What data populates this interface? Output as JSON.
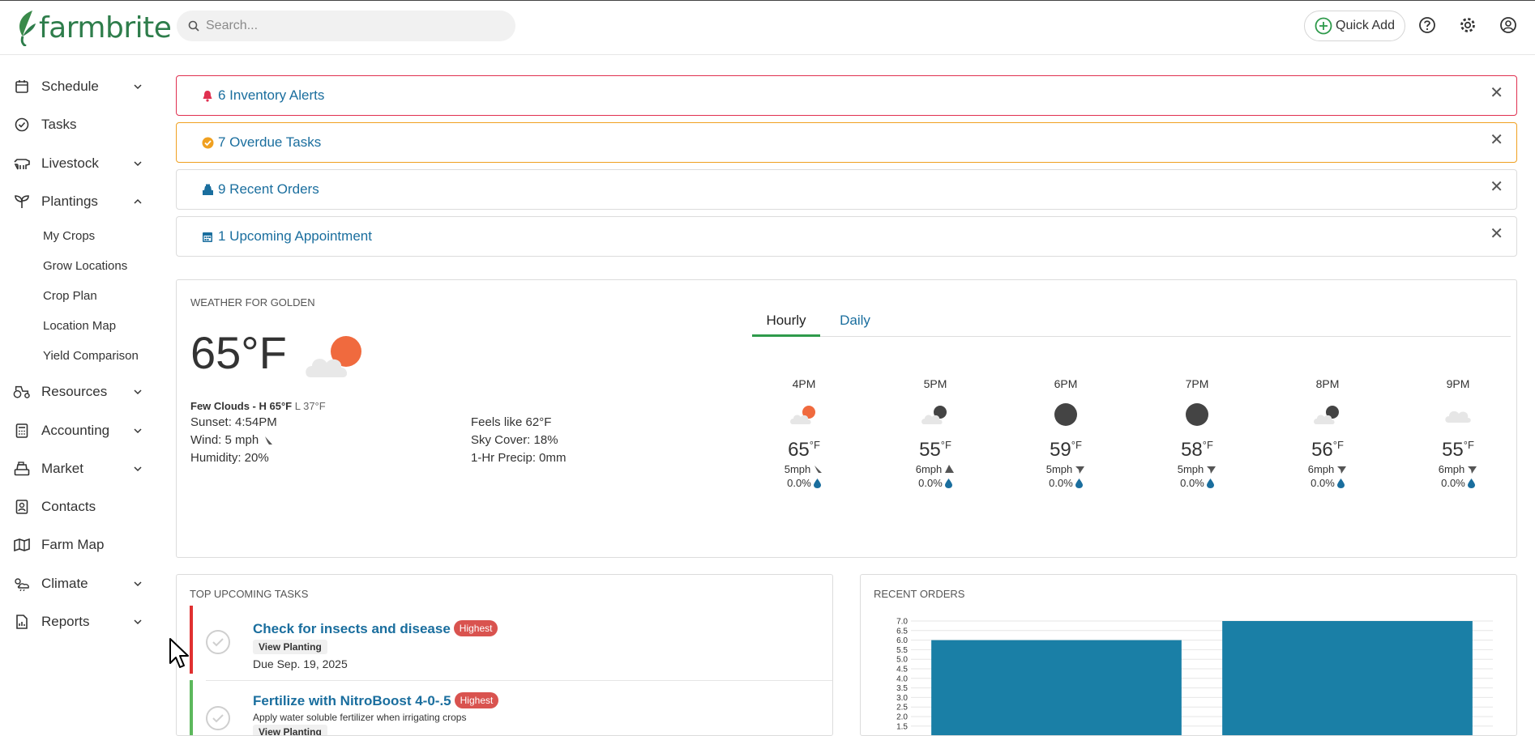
{
  "brand": {
    "name": "farmbrite",
    "logo_color": "#2e7d4b"
  },
  "search": {
    "placeholder": "Search..."
  },
  "header": {
    "quick_add_label": "Quick Add",
    "icons": [
      "plus-circle-icon",
      "help-icon",
      "gear-icon",
      "user-icon"
    ]
  },
  "sidebar": {
    "items": [
      {
        "label": "Schedule",
        "icon": "calendar-icon",
        "expandable": true
      },
      {
        "label": "Tasks",
        "icon": "check-circle-icon",
        "expandable": false
      },
      {
        "label": "Livestock",
        "icon": "cow-icon",
        "expandable": true
      },
      {
        "label": "Plantings",
        "icon": "sprout-icon",
        "expandable": true,
        "expanded": true
      },
      {
        "label": "Resources",
        "icon": "tractor-icon",
        "expandable": true
      },
      {
        "label": "Accounting",
        "icon": "calculator-icon",
        "expandable": true
      },
      {
        "label": "Market",
        "icon": "cash-register-icon",
        "expandable": true
      },
      {
        "label": "Contacts",
        "icon": "contact-card-icon",
        "expandable": false
      },
      {
        "label": "Farm Map",
        "icon": "map-icon",
        "expandable": false
      },
      {
        "label": "Climate",
        "icon": "weather-icon",
        "expandable": true
      },
      {
        "label": "Reports",
        "icon": "report-icon",
        "expandable": true
      }
    ],
    "plantings_sub": [
      "My Crops",
      "Grow Locations",
      "Crop Plan",
      "Location Map",
      "Yield Comparison"
    ]
  },
  "alerts": [
    {
      "label": "6 Inventory Alerts",
      "icon": "bell-icon",
      "color": "#e03050"
    },
    {
      "label": "7 Overdue Tasks",
      "icon": "check-badge-icon",
      "color": "#f0a020"
    },
    {
      "label": "9 Recent Orders",
      "icon": "cash-register-icon",
      "color": "#dcdcdc"
    },
    {
      "label": "1 Upcoming Appointment",
      "icon": "calendar-icon",
      "color": "#dcdcdc"
    }
  ],
  "weather": {
    "title": "WEATHER FOR GOLDEN",
    "current_temp": "65°F",
    "summary_bold": "Few Clouds - H 65°F",
    "summary_low": "L 37°F",
    "sunset": "Sunset: 4:54PM",
    "wind": "Wind: 5 mph",
    "humidity": "Humidity: 20%",
    "feels_like": "Feels like 62°F",
    "sky_cover": "Sky Cover: 18%",
    "precip": "1-Hr Precip: 0mm",
    "tabs": [
      "Hourly",
      "Daily"
    ],
    "active_tab": "Hourly",
    "hourly": [
      {
        "time": "4PM",
        "temp": "65",
        "unit": "°F",
        "wind": "5mph",
        "precip": "0.0%",
        "icon": "sun-cloud-icon"
      },
      {
        "time": "5PM",
        "temp": "55",
        "unit": "°F",
        "wind": "6mph",
        "precip": "0.0%",
        "icon": "moon-cloud-icon"
      },
      {
        "time": "6PM",
        "temp": "59",
        "unit": "°F",
        "wind": "5mph",
        "precip": "0.0%",
        "icon": "moon-icon"
      },
      {
        "time": "7PM",
        "temp": "58",
        "unit": "°F",
        "wind": "5mph",
        "precip": "0.0%",
        "icon": "moon-icon"
      },
      {
        "time": "8PM",
        "temp": "56",
        "unit": "°F",
        "wind": "6mph",
        "precip": "0.0%",
        "icon": "moon-cloud-icon"
      },
      {
        "time": "9PM",
        "temp": "55",
        "unit": "°F",
        "wind": "6mph",
        "precip": "0.0%",
        "icon": "cloud-icon"
      }
    ]
  },
  "tasks": {
    "title": "TOP UPCOMING TASKS",
    "items": [
      {
        "title": "Check for insects and disease",
        "priority": "Highest",
        "action": "View Planting",
        "due": "Due Sep. 19, 2025",
        "bar_color": "#e03030"
      },
      {
        "title": "Fertilize with NitroBoost 4-0-.5",
        "priority": "Highest",
        "description": "Apply water soluble fertilizer when irrigating crops",
        "action": "View Planting",
        "bar_color": "#5cb85c"
      }
    ]
  },
  "orders": {
    "title": "RECENT ORDERS"
  },
  "chart_data": {
    "type": "bar",
    "title": "RECENT ORDERS",
    "categories": [
      "",
      ""
    ],
    "values": [
      6,
      7
    ],
    "yticks": [
      "7.0",
      "6.5",
      "6.0",
      "5.5",
      "5.0",
      "4.5",
      "4.0",
      "3.5",
      "3.0",
      "2.5",
      "2.0",
      "1.5"
    ],
    "ylim": [
      1.5,
      7.0
    ],
    "bar_color": "#1a7fa6",
    "grid": true
  }
}
